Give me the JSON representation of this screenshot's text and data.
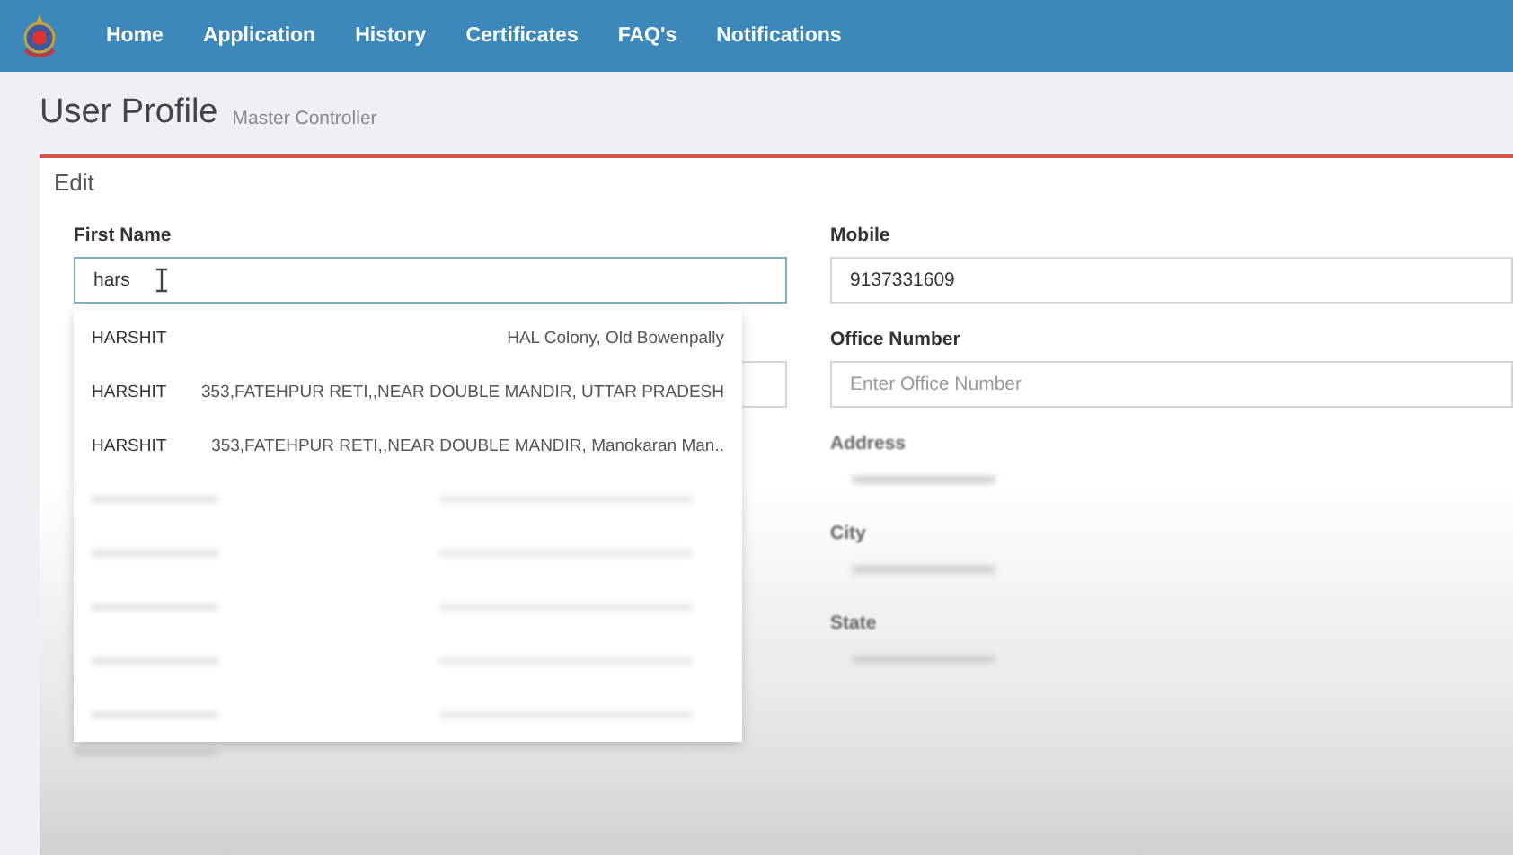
{
  "nav": {
    "items": [
      "Home",
      "Application",
      "History",
      "Certificates",
      "FAQ's",
      "Notifications"
    ]
  },
  "header": {
    "title": "User Profile",
    "subtitle": "Master Controller"
  },
  "panel": {
    "title": "Edit"
  },
  "first_name": {
    "label": "First Name",
    "value": "hars"
  },
  "suggestions": [
    {
      "name": "HARSHIT",
      "address": "HAL Colony, Old Bowenpally"
    },
    {
      "name": "HARSHIT",
      "address": "353,FATEHPUR RETI,,NEAR DOUBLE MANDIR, UTTAR PRADESH"
    },
    {
      "name": "HARSHIT",
      "address": "353,FATEHPUR RETI,,NEAR DOUBLE MANDIR, Manokaran Man.."
    }
  ],
  "right_fields": [
    {
      "kind": "input",
      "label": "Mobile",
      "value": "9137331609"
    },
    {
      "kind": "input",
      "label": "Office Number",
      "placeholder": "Enter Office Number"
    },
    {
      "kind": "redacted",
      "label": "Address"
    },
    {
      "kind": "redacted",
      "label": "City"
    },
    {
      "kind": "redacted",
      "label": "State"
    }
  ]
}
